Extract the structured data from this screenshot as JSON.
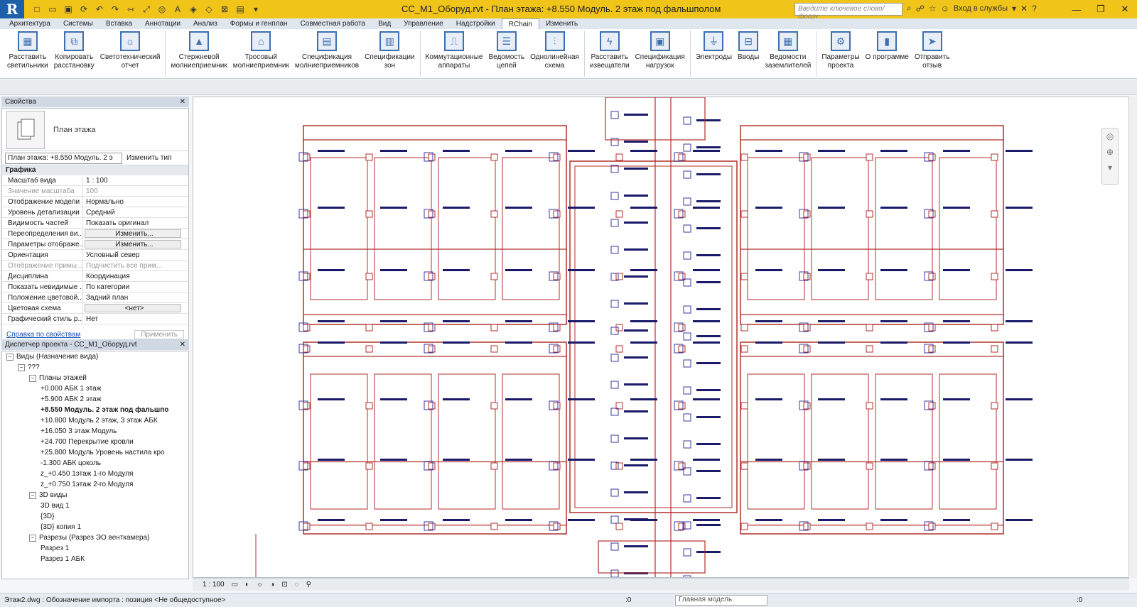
{
  "app": {
    "logo": "R",
    "title": "СС_М1_Оборуд.rvt - План этажа: +8.550 Модуль. 2 этаж под фальшполом"
  },
  "search_placeholder": "Введите ключевое слово/фразу",
  "login_label": "Вход в службы",
  "tabs": [
    "Архитектура",
    "Системы",
    "Вставка",
    "Аннотации",
    "Анализ",
    "Формы и генплан",
    "Совместная работа",
    "Вид",
    "Управление",
    "Надстройки",
    "RChain",
    "Изменить"
  ],
  "active_tab": "RChain",
  "ribbon": [
    {
      "label": "Расставить\nсветильники",
      "icon": "grid-icon"
    },
    {
      "label": "Копировать\nрасстановку",
      "icon": "copy-icon"
    },
    {
      "label": "Светотехнический\nотчет",
      "icon": "bulb-icon"
    },
    {
      "label": "Стержневой\nмолниеприемник",
      "icon": "rod-icon"
    },
    {
      "label": "Тросовый\nмолниеприемник",
      "icon": "cable-icon"
    },
    {
      "label": "Спецификация\nмолниеприемников",
      "icon": "spec-icon"
    },
    {
      "label": "Спецификации\nзон",
      "icon": "zone-icon"
    },
    {
      "label": "Коммутационные\nаппараты",
      "icon": "switch-icon"
    },
    {
      "label": "Ведомость\nцепей",
      "icon": "list-icon"
    },
    {
      "label": "Однолинейная\nсхема",
      "icon": "scheme-icon"
    },
    {
      "label": "Расставить\nизвещатели",
      "icon": "detector-icon"
    },
    {
      "label": "Спецификация\nнагрузок",
      "icon": "load-icon"
    },
    {
      "label": "Электроды",
      "icon": "ground-icon"
    },
    {
      "label": "Вводы",
      "icon": "input-icon"
    },
    {
      "label": "Ведомости\nзаземлителей",
      "icon": "table-icon"
    },
    {
      "label": "Параметры\nпроекта",
      "icon": "gear-icon"
    },
    {
      "label": "О программе",
      "icon": "info-icon"
    },
    {
      "label": "Отправить\nотзыв",
      "icon": "send-icon"
    }
  ],
  "properties": {
    "header": "Свойства",
    "type_name": "План этажа",
    "instance": "План этажа: +8.550 Модуль. 2 э",
    "edit_type": "Изменить тип",
    "group": "Графика",
    "rows": [
      {
        "k": "Масштаб вида",
        "v": "1 : 100"
      },
      {
        "k": "Значение масштаба",
        "v": "100",
        "dim": true
      },
      {
        "k": "Отображение модели",
        "v": "Нормально"
      },
      {
        "k": "Уровень детализации",
        "v": "Средний"
      },
      {
        "k": "Видимость частей",
        "v": "Показать оригинал"
      },
      {
        "k": "Переопределения ви...",
        "v": "Изменить...",
        "btn": true
      },
      {
        "k": "Параметры отображе...",
        "v": "Изменить...",
        "btn": true
      },
      {
        "k": "Ориентация",
        "v": "Условный север"
      },
      {
        "k": "Отображение примы...",
        "v": "Подчистить все прим...",
        "dim": true
      },
      {
        "k": "Дисциплина",
        "v": "Координация"
      },
      {
        "k": "Показать невидимые ...",
        "v": "По категории"
      },
      {
        "k": "Положение цветовой...",
        "v": "Задний план"
      },
      {
        "k": "Цветовая схема",
        "v": "<нет>",
        "btn": true
      },
      {
        "k": "Графический стиль р...",
        "v": "Нет"
      }
    ],
    "help": "Справка по свойствам",
    "apply": "Применить"
  },
  "browser": {
    "header": "Диспетчер проекта - СС_М1_Оборуд.rvt",
    "nodes": [
      {
        "t": "Виды (Назначение вида)",
        "lvl": 0,
        "tog": "−"
      },
      {
        "t": "???",
        "lvl": 1,
        "tog": "−"
      },
      {
        "t": "Планы этажей",
        "lvl": 2,
        "tog": "−"
      },
      {
        "t": "+0.000 АБК 1 этаж",
        "lvl": 3
      },
      {
        "t": "+5.900 АБК 2 этаж",
        "lvl": 3
      },
      {
        "t": "+8.550 Модуль. 2 этаж под фальшпо",
        "lvl": 3,
        "bold": true
      },
      {
        "t": "+10.800 Модуль 2 этаж, 3 этаж АБК",
        "lvl": 3
      },
      {
        "t": "+16.050 3 этаж Модуль",
        "lvl": 3
      },
      {
        "t": "+24.700 Перекрытие кровли",
        "lvl": 3
      },
      {
        "t": "+25.800 Модуль Уровень настила кро",
        "lvl": 3
      },
      {
        "t": "-1.300 АБК цоколь",
        "lvl": 3
      },
      {
        "t": "z_+0.450 1этаж 1-го Модуля",
        "lvl": 3
      },
      {
        "t": "z_+0.750 1этаж 2-го Модуля",
        "lvl": 3
      },
      {
        "t": "3D виды",
        "lvl": 2,
        "tog": "−"
      },
      {
        "t": "3D вид 1",
        "lvl": 3
      },
      {
        "t": "{3D}",
        "lvl": 3
      },
      {
        "t": "{3D} копия 1",
        "lvl": 3
      },
      {
        "t": "Разрезы (Разрез ЭО венткамера)",
        "lvl": 2,
        "tog": "−"
      },
      {
        "t": "Разрез 1",
        "lvl": 3
      },
      {
        "t": "Разрез 1 АБК",
        "lvl": 3
      }
    ]
  },
  "view_bar": {
    "scale": "1 : 100"
  },
  "status": {
    "text": "Этаж2.dwg : Обозначение импорта : позиция <Не общедоступное>",
    "zero": ":0",
    "model": "Главная модель",
    "zero2": ":0"
  }
}
